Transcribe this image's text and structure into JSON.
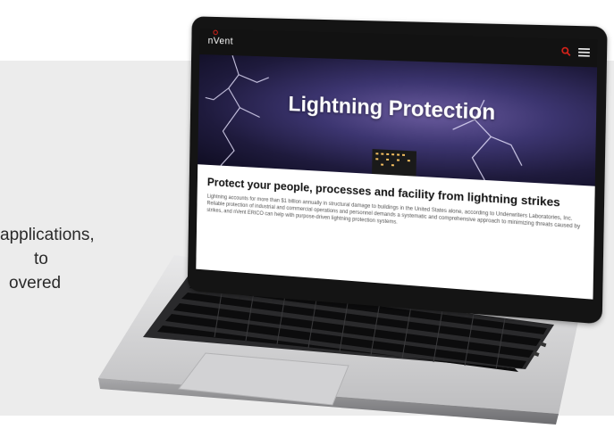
{
  "background_text": {
    "lines": [
      "applications,",
      "to",
      "overed"
    ]
  },
  "website": {
    "logo": "nVent",
    "hero_title": "Lightning Protection",
    "heading": "Protect your people, processes and facility from lightning strikes",
    "body": "Lightning accounts for more than $1 billion annually in structural damage to buildings in the United States alone, according to Underwriters Laboratories, Inc. Reliable protection of industrial and commercial operations and personnel demands a systematic and comprehensive approach to minimizing threats caused by strikes, and nVent ERICO can help with purpose-driven lightning protection systems."
  },
  "colors": {
    "accent": "#e2231a",
    "header_bg": "#121212",
    "hero_sky": "#3c3570",
    "page_gray": "#ececec"
  },
  "icons": {
    "search": "search-icon",
    "menu": "menu-icon",
    "logo_mark": "nvent-logo-icon"
  }
}
